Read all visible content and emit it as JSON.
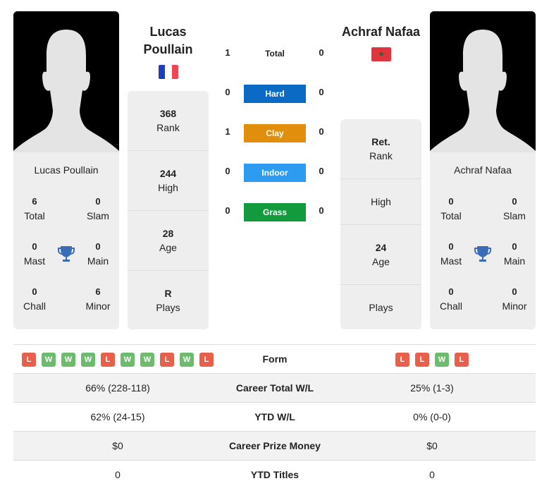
{
  "player1": {
    "name_line1": "Lucas",
    "name_line2": "Poullain",
    "full_name": "Lucas Poullain",
    "flag": "France",
    "titles": {
      "total": {
        "value": "6",
        "label": "Total"
      },
      "slam": {
        "value": "0",
        "label": "Slam"
      },
      "mast": {
        "value": "0",
        "label": "Mast"
      },
      "main": {
        "value": "0",
        "label": "Main"
      },
      "chall": {
        "value": "0",
        "label": "Chall"
      },
      "minor": {
        "value": "6",
        "label": "Minor"
      }
    },
    "stats": {
      "rank": {
        "value": "368",
        "label": "Rank"
      },
      "high": {
        "value": "244",
        "label": "High"
      },
      "age": {
        "value": "28",
        "label": "Age"
      },
      "plays": {
        "value": "R",
        "label": "Plays"
      }
    },
    "form": [
      "L",
      "W",
      "W",
      "W",
      "L",
      "W",
      "W",
      "L",
      "W",
      "L"
    ]
  },
  "player2": {
    "name": "Achraf Nafaa",
    "full_name": "Achraf Nafaa",
    "flag": "Morocco",
    "titles": {
      "total": {
        "value": "0",
        "label": "Total"
      },
      "slam": {
        "value": "0",
        "label": "Slam"
      },
      "mast": {
        "value": "0",
        "label": "Mast"
      },
      "main": {
        "value": "0",
        "label": "Main"
      },
      "chall": {
        "value": "0",
        "label": "Chall"
      },
      "minor": {
        "value": "0",
        "label": "Minor"
      }
    },
    "stats": {
      "rank": {
        "value": "Ret.",
        "label": "Rank"
      },
      "high": {
        "value": "",
        "label": "High"
      },
      "age": {
        "value": "24",
        "label": "Age"
      },
      "plays": {
        "value": "",
        "label": "Plays"
      }
    },
    "form": [
      "L",
      "L",
      "W",
      "L"
    ]
  },
  "h2h": {
    "total": {
      "label": "Total",
      "p1": "1",
      "p2": "0"
    },
    "surfaces": [
      {
        "label": "Hard",
        "p1": "0",
        "p2": "0",
        "color": "#0b6bc4"
      },
      {
        "label": "Clay",
        "p1": "1",
        "p2": "0",
        "color": "#e08e0b"
      },
      {
        "label": "Indoor",
        "p1": "0",
        "p2": "0",
        "color": "#2d9cf0"
      },
      {
        "label": "Grass",
        "p1": "0",
        "p2": "0",
        "color": "#129a3c"
      }
    ]
  },
  "comparison": {
    "form_label": "Form",
    "rows": [
      {
        "label": "Career Total W/L",
        "p1": "66% (228-118)",
        "p2": "25% (1-3)"
      },
      {
        "label": "YTD W/L",
        "p1": "62% (24-15)",
        "p2": "0% (0-0)"
      },
      {
        "label": "Career Prize Money",
        "p1": "$0",
        "p2": "$0"
      },
      {
        "label": "YTD Titles",
        "p1": "0",
        "p2": "0"
      }
    ]
  },
  "colors": {
    "win": "#6dbb6d",
    "loss": "#e8604c",
    "trophy": "#3b6cb7",
    "card_bg": "#eeeeee"
  }
}
